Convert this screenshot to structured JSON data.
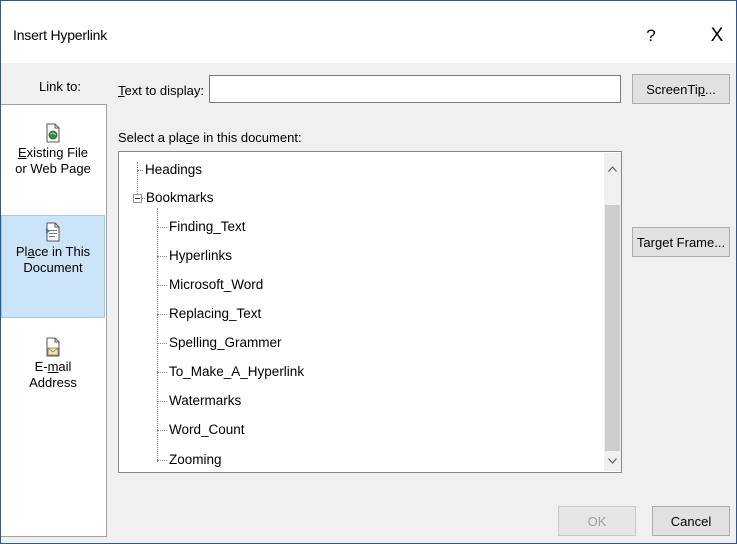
{
  "window": {
    "title": "Insert Hyperlink",
    "help_label": "?",
    "close_label": "X"
  },
  "link_to": {
    "label": "Link to:",
    "items": [
      {
        "key": "E",
        "rest": "xisting File",
        "line2": "or Web Page",
        "selected": false,
        "icon": "existing-file-icon"
      },
      {
        "pre": "Pl",
        "key": "a",
        "rest": "ce in This",
        "line2": "Document",
        "selected": true,
        "icon": "place-in-document-icon"
      },
      {
        "pre": "E-",
        "key": "m",
        "rest": "ail",
        "line2": "Address",
        "selected": false,
        "icon": "email-address-icon"
      }
    ]
  },
  "text_to_display": {
    "key": "T",
    "label_rest": "ext to display:",
    "value": ""
  },
  "buttons": {
    "screentip_pre": "ScreenTi",
    "screentip_key": "p",
    "screentip_post": "...",
    "target_frame_pre": "Tar",
    "target_frame_key": "g",
    "target_frame_post": "et Frame...",
    "ok": "OK",
    "cancel": "Cancel"
  },
  "place": {
    "label_pre": "Select a pla",
    "label_key": "c",
    "label_post": "e in this document:",
    "tree": {
      "headings": "Headings",
      "bookmarks": "Bookmarks",
      "bookmark_items": [
        "Finding_Text",
        "Hyperlinks",
        "Microsoft_Word",
        "Replacing_Text",
        "Spelling_Grammer",
        "To_Make_A_Hyperlink",
        "Watermarks",
        "Word_Count",
        "Zooming"
      ]
    }
  },
  "colors": {
    "accent": "#2b579a",
    "selected_bg": "#cce4f7",
    "selected_border": "#99c9ef"
  }
}
